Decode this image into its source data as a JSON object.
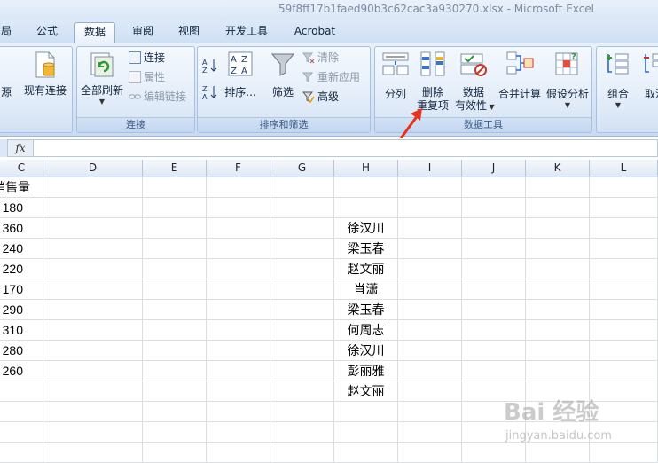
{
  "window": {
    "title": "59f8ff17b1faed90b3c62cac3a930270.xlsx - Microsoft Excel"
  },
  "tabs": [
    {
      "label": "局",
      "active": false
    },
    {
      "label": "公式",
      "active": false
    },
    {
      "label": "数据",
      "active": true
    },
    {
      "label": "审阅",
      "active": false
    },
    {
      "label": "视图",
      "active": false
    },
    {
      "label": "开发工具",
      "active": false
    },
    {
      "label": "Acrobat",
      "active": false
    }
  ],
  "ribbon": {
    "get_external": {
      "source_label": "源",
      "existing_conn_label": "现有连接"
    },
    "connections": {
      "group_label": "连接",
      "refresh_all_label": "全部刷新",
      "connections_label": "连接",
      "properties_label": "属性",
      "edit_links_label": "编辑链接"
    },
    "sort_filter": {
      "group_label": "排序和筛选",
      "sort_label": "排序...",
      "filter_label": "筛选",
      "clear_label": "清除",
      "reapply_label": "重新应用",
      "advanced_label": "高级"
    },
    "data_tools": {
      "group_label": "数据工具",
      "text_to_columns_label": "分列",
      "remove_dup_line1": "删除",
      "remove_dup_line2": "重复项",
      "validation_line1": "数据",
      "validation_line2": "有效性",
      "consolidate_label": "合并计算",
      "whatif_label": "假设分析"
    },
    "outline": {
      "group_label": "组合",
      "ungroup_label": "取消"
    }
  },
  "formula_bar": {
    "fx_label": "fx",
    "value": ""
  },
  "columns": [
    "C",
    "D",
    "E",
    "F",
    "G",
    "H",
    "I",
    "J",
    "K",
    "L"
  ],
  "rows": [
    {
      "c": "销售量",
      "h": ""
    },
    {
      "c": "180",
      "h": ""
    },
    {
      "c": "360",
      "h": "徐汉川"
    },
    {
      "c": "240",
      "h": "梁玉春"
    },
    {
      "c": "220",
      "h": "赵文丽"
    },
    {
      "c": "170",
      "h": "肖潇"
    },
    {
      "c": "290",
      "h": "梁玉春"
    },
    {
      "c": "310",
      "h": "何周志"
    },
    {
      "c": "280",
      "h": "徐汉川"
    },
    {
      "c": "260",
      "h": "彭丽雅"
    },
    {
      "c": "",
      "h": "赵文丽"
    },
    {
      "c": "",
      "h": ""
    },
    {
      "c": "",
      "h": ""
    },
    {
      "c": "",
      "h": ""
    }
  ],
  "watermark": {
    "logo": "Bai 经验",
    "url": "jingyan.baidu.com"
  },
  "colors": {
    "accent": "#e8321e",
    "ribbon": "#d4e3f5"
  }
}
